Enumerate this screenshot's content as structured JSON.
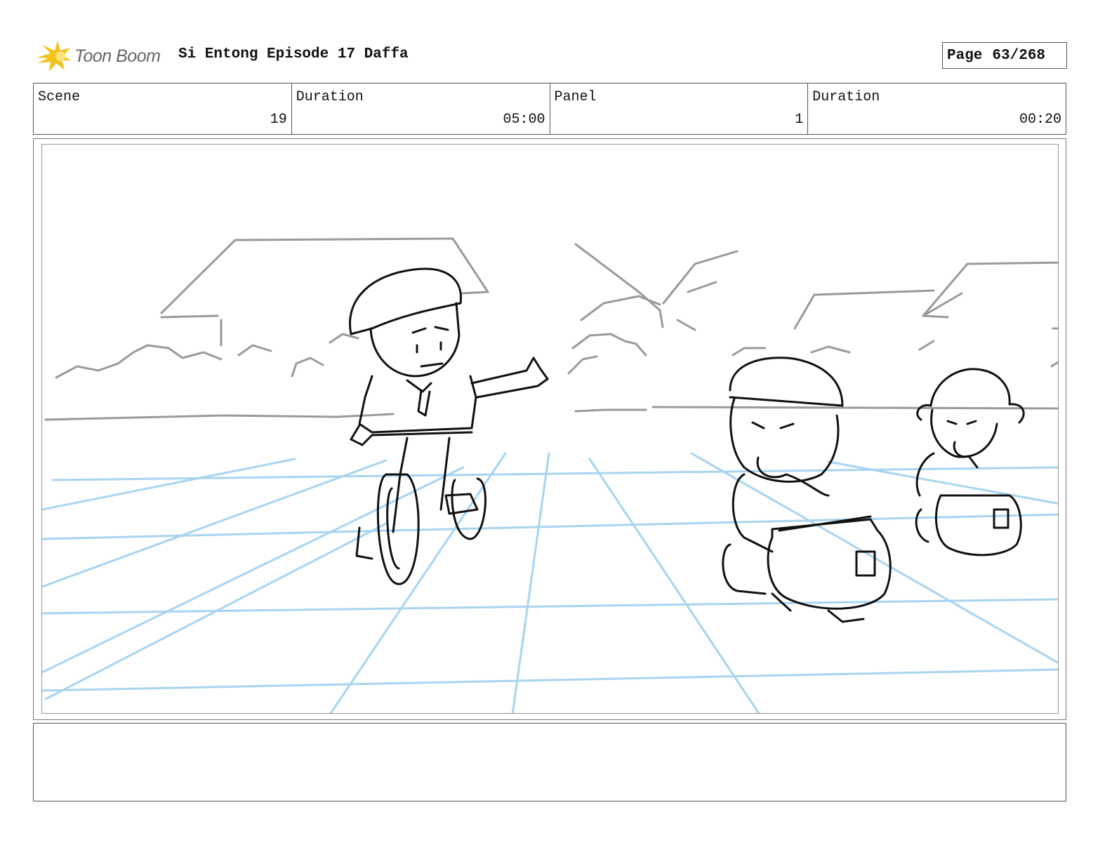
{
  "header": {
    "logo_text": "Toon Boom",
    "title": "Si Entong Episode 17 Daffa",
    "page_label": "Page",
    "page_value": "63/268"
  },
  "info": {
    "scene_label": "Scene",
    "scene_value": "19",
    "duration1_label": "Duration",
    "duration1_value": "05:00",
    "panel_label": "Panel",
    "panel_value": "1",
    "duration2_label": "Duration",
    "duration2_value": "00:20"
  },
  "notes": {
    "text": ""
  },
  "colors": {
    "sketch": "#111111",
    "background_sketch": "#9a9a9a",
    "grid": "#a8d4f0",
    "logo_flame": "#f5c21b"
  }
}
